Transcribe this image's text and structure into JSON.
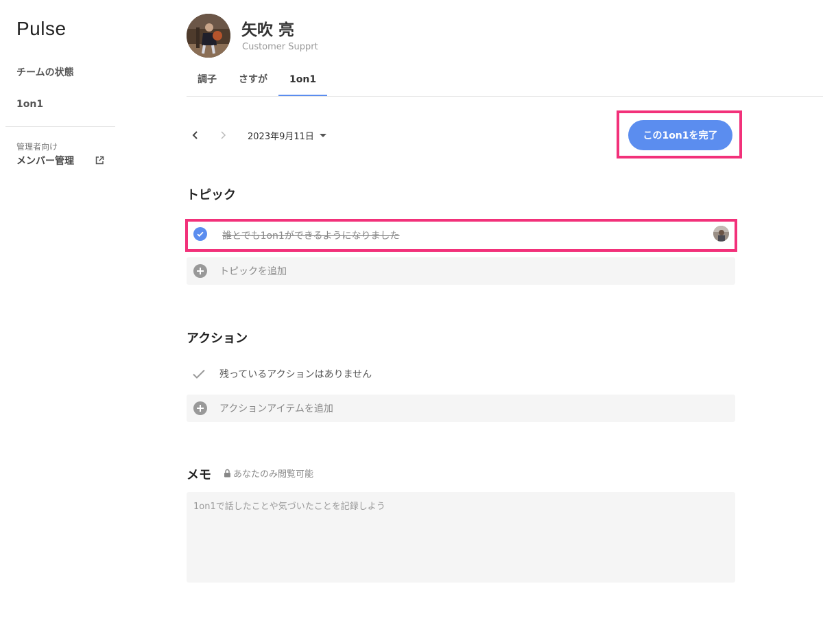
{
  "app": {
    "name": "Pulse"
  },
  "sidebar": {
    "items": [
      {
        "label": "チームの状態"
      },
      {
        "label": "1on1"
      }
    ],
    "admin_caption": "管理者向け",
    "member_management": {
      "label": "メンバー管理",
      "icon": "external-link-icon"
    }
  },
  "profile": {
    "name": "矢吹 亮",
    "role": "Customer Supprt"
  },
  "tabs": [
    {
      "label": "調子",
      "active": false
    },
    {
      "label": "さすが",
      "active": false
    },
    {
      "label": "1on1",
      "active": true
    }
  ],
  "date_nav": {
    "date": "2023年9月11日",
    "prev_icon": "chevron-left-icon",
    "next_icon": "chevron-right-icon"
  },
  "complete_button": {
    "label": "この1on1を完了"
  },
  "topics": {
    "title": "トピック",
    "items": [
      {
        "text": "誰とでも1on1ができるようになりました",
        "done": true
      }
    ],
    "add_label": "トピックを追加"
  },
  "actions": {
    "title": "アクション",
    "empty_text": "残っているアクションはありません",
    "add_label": "アクションアイテムを追加"
  },
  "memo": {
    "title": "メモ",
    "privacy_note": "あなたのみ閲覧可能",
    "placeholder": "1on1で話したことや気づいたことを記録しよう"
  },
  "colors": {
    "accent": "#5b8def",
    "highlight": "#f2317a"
  }
}
